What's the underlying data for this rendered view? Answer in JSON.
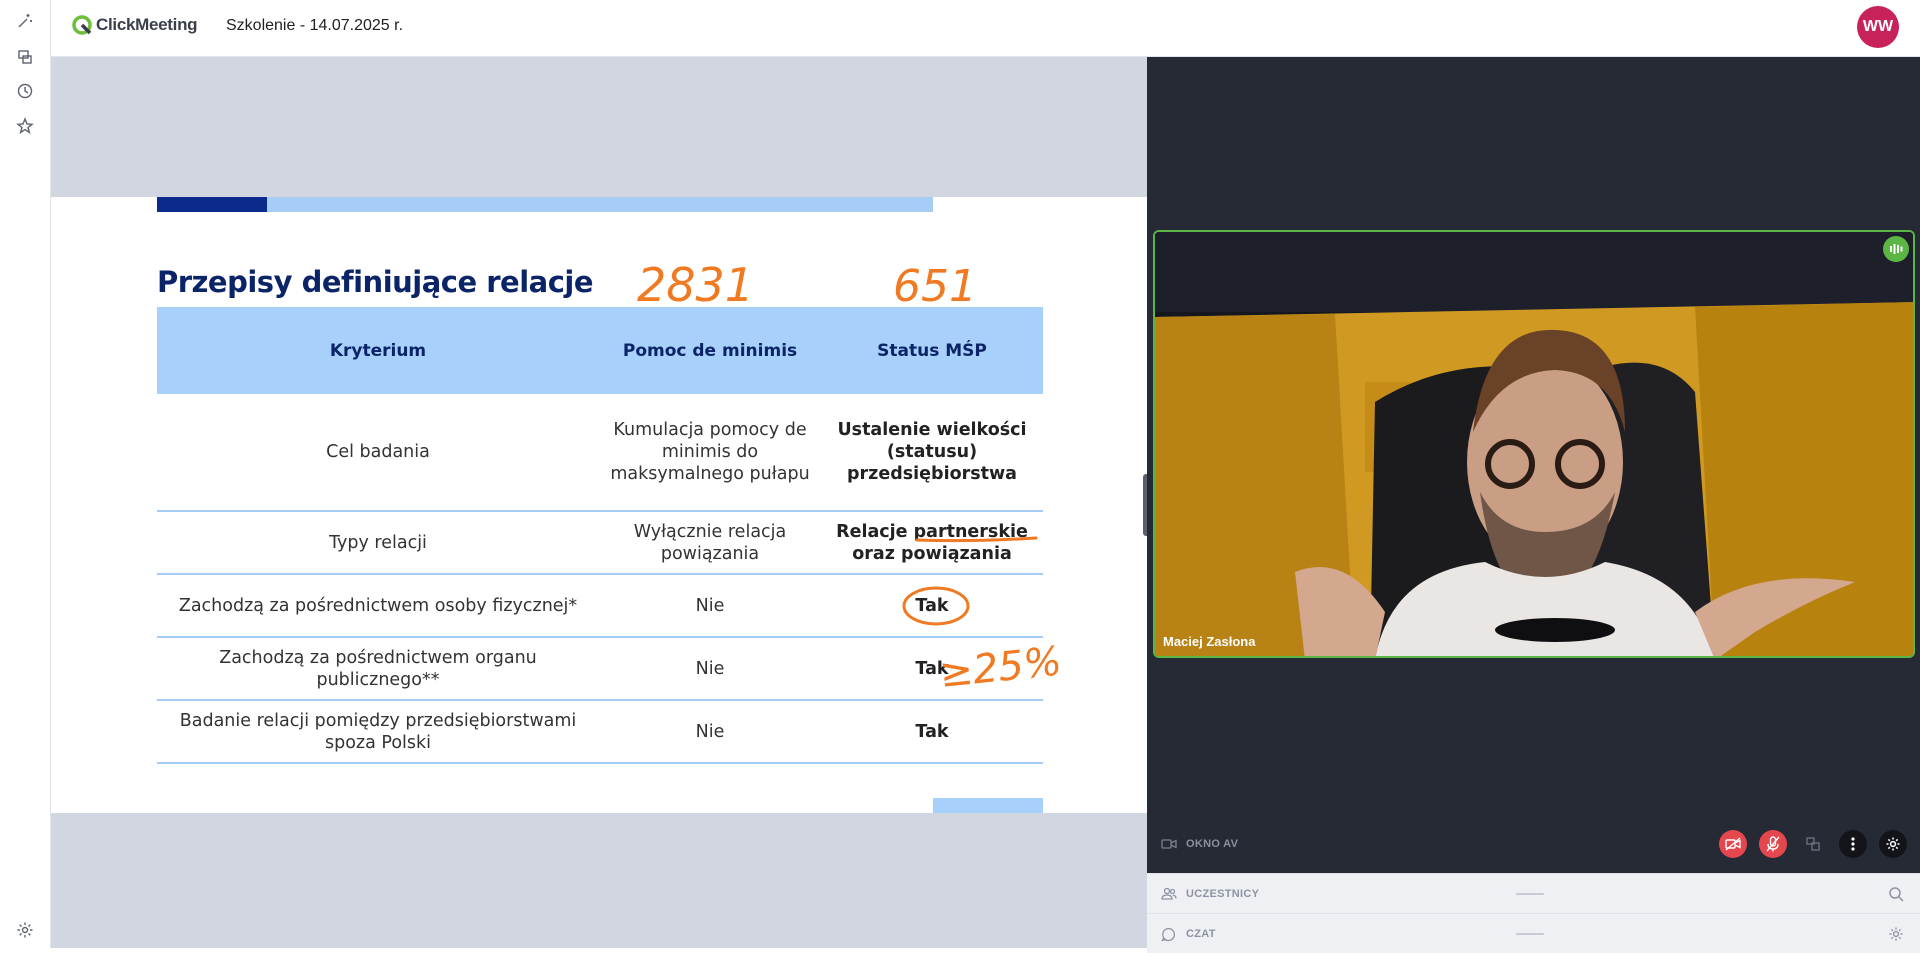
{
  "app": {
    "name": "ClickMeeting",
    "meeting_title": "Szkolenie - 14.07.2025 r.",
    "user_initials": "WW"
  },
  "left_rail": {
    "icons": [
      "magic-icon",
      "presentation-icon",
      "history-icon",
      "star-icon",
      "settings-icon"
    ]
  },
  "slide": {
    "title": "Przepisy definiujące relacje",
    "headers": [
      "Kryterium",
      "Pomoc de minimis",
      "Status MŚP"
    ],
    "rows": [
      {
        "c1": "Cel badania",
        "c2": "Kumulacja pomocy de minimis do maksymalnego pułapu",
        "c3": "Ustalenie wielkości (statusu) przedsiębiorstwa"
      },
      {
        "c1": "Typy relacji",
        "c2": "Wyłącznie relacja powiązania",
        "c3": "Relacje partnerskie oraz powiązania"
      },
      {
        "c1": "Zachodzą za pośrednictwem osoby fizycznej*",
        "c2": "Nie",
        "c3": "Tak"
      },
      {
        "c1": "Zachodzą za pośrednictwem organu publicznego**",
        "c2": "Nie",
        "c3": "Tak"
      },
      {
        "c1": "Badanie relacji pomiędzy przedsiębiorstwami spoza Polski",
        "c2": "Nie",
        "c3": "Tak"
      }
    ],
    "annotations": {
      "num1": "2831",
      "num2": "651",
      "pct": "≥25%"
    },
    "ink_color": "#f07a22"
  },
  "video": {
    "speaker": "Maciej Zasłona",
    "active_border": "#5bb644"
  },
  "av_window": {
    "label": "OKNO AV",
    "controls": [
      "camera-off-icon",
      "mic-off-icon",
      "layout-icon",
      "more-icon",
      "settings-icon"
    ],
    "off_color": "#e5474f"
  },
  "panels": {
    "participants": "UCZESTNICY",
    "chat": "CZAT"
  }
}
